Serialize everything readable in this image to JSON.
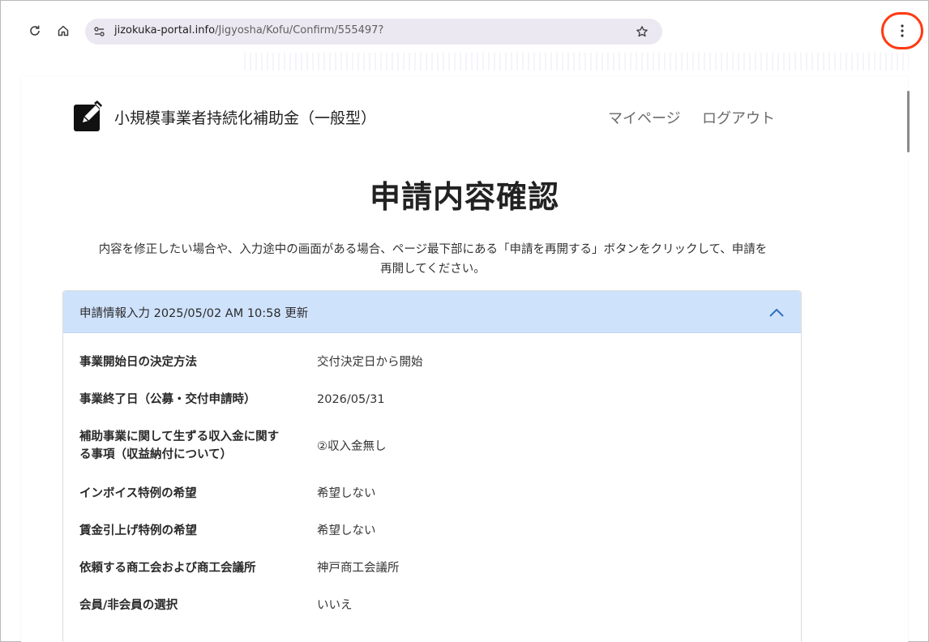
{
  "browser": {
    "url_host": "jizokuka-portal.info",
    "url_path": "/Jigyosha/Kofu/Confirm/555497?",
    "icons": [
      "reload-icon",
      "home-icon",
      "site-settings-icon",
      "star-icon",
      "more-vert-icon"
    ],
    "highlight_color": "#ff3b13"
  },
  "site": {
    "title": "小規模事業者持続化補助金（一般型）",
    "nav": {
      "mypage": "マイページ",
      "logout": "ログアウト"
    }
  },
  "page": {
    "title": "申請内容確認",
    "intro_line1": "内容を修正したい場合や、入力途中の画面がある場合、ページ最下部にある「申請を再開する」ボタンをクリックして、申請を",
    "intro_line2": "再開してください。"
  },
  "section": {
    "header": "申請情報入力 2025/05/02 AM 10:58 更新",
    "header_color": "#cfe2fc",
    "rows": [
      {
        "label": "事業開始日の決定方法",
        "value": "交付決定日から開始"
      },
      {
        "label": "事業終了日（公募・交付申請時）",
        "value": "2026/05/31"
      },
      {
        "label_line1": "補助事業に関して生ずる収入金に関す",
        "label_line2": "る事項（収益納付について）",
        "value": "②収入金無し"
      },
      {
        "label": "インボイス特例の希望",
        "value": "希望しない"
      },
      {
        "label": "賃金引上げ特例の希望",
        "value": "希望しない"
      },
      {
        "label": "依頼する商工会および商工会議所",
        "value": "神戸商工会議所"
      },
      {
        "label": "会員/非会員の選択",
        "value": "いいえ"
      }
    ]
  }
}
